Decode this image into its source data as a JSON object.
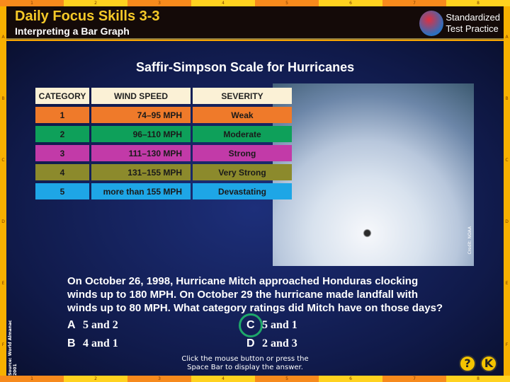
{
  "ruler": {
    "columns": [
      "1",
      "2",
      "3",
      "4",
      "5",
      "6",
      "7",
      "8"
    ],
    "rows": [
      "A",
      "B",
      "C",
      "D",
      "E",
      "F"
    ]
  },
  "header": {
    "title": "Daily Focus Skills 3-3",
    "subtitle": "Interpreting a Bar Graph",
    "badge_line1": "Standardized",
    "badge_line2": "Test Practice"
  },
  "table_title": "Saffir-Simpson Scale for Hurricanes",
  "table": {
    "headers": [
      "CATEGORY",
      "WIND SPEED",
      "SEVERITY"
    ],
    "rows": [
      {
        "category": "1",
        "wind": "74–95 MPH",
        "severity": "Weak",
        "color": "#ef7a2a"
      },
      {
        "category": "2",
        "wind": "96–110 MPH",
        "severity": "Moderate",
        "color": "#0ea05a"
      },
      {
        "category": "3",
        "wind": "111–130 MPH",
        "severity": "Strong",
        "color": "#c23aa8"
      },
      {
        "category": "4",
        "wind": "131–155 MPH",
        "severity": "Very Strong",
        "color": "#8c8a2c"
      },
      {
        "category": "5",
        "wind": "more than 155 MPH",
        "severity": "Devastating",
        "color": "#1ea6e6"
      }
    ]
  },
  "credit": "Credit: NOAA",
  "source": "Source: World Almanac 2001",
  "question": "On October 26, 1998, Hurricane Mitch approached Honduras clocking winds up to 180 MPH. On October 29 the hurricane made landfall with winds up to 80 MPH. What category ratings did Mitch have on those days?",
  "options": [
    {
      "letter": "A",
      "text": "5 and 2"
    },
    {
      "letter": "B",
      "text": "4 and 1"
    },
    {
      "letter": "C",
      "text": "5 and 1"
    },
    {
      "letter": "D",
      "text": "2 and 3"
    }
  ],
  "selected_answer": "C",
  "hint": "Click the mouse button or press the Space Bar to display the answer.",
  "buttons": {
    "help": "?",
    "back": "K"
  }
}
